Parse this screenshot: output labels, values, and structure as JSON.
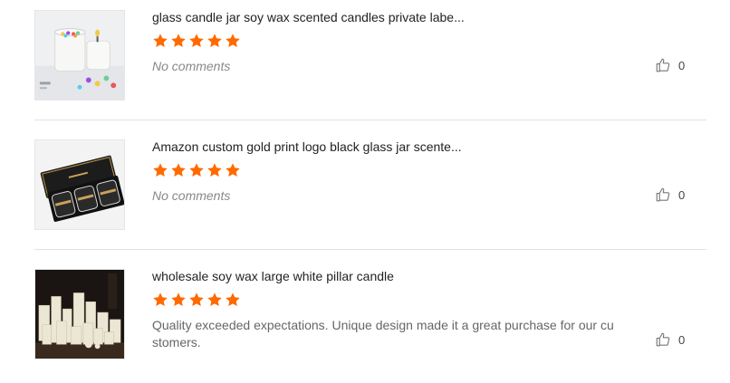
{
  "reviews": [
    {
      "product_title": "glass candle jar soy wax scented candles private labe...",
      "rating": 5,
      "comment": "No comments",
      "likes": "0",
      "thumbnail_icon": "candle-jar-photo"
    },
    {
      "product_title": "Amazon custom gold print logo black glass jar scente...",
      "rating": 5,
      "comment": "No comments",
      "likes": "0",
      "thumbnail_icon": "black-gift-box-photo"
    },
    {
      "product_title": "wholesale soy wax large white pillar candle",
      "rating": 5,
      "comment": "Quality exceeded expectations. Unique design made it a great purchase for our cu stomers.",
      "likes": "0",
      "thumbnail_icon": "pillar-candles-photo"
    }
  ],
  "colors": {
    "star": "#ff6a00",
    "divider": "#e2e2e2",
    "title_text": "#222222",
    "comment_text": "#666666"
  }
}
